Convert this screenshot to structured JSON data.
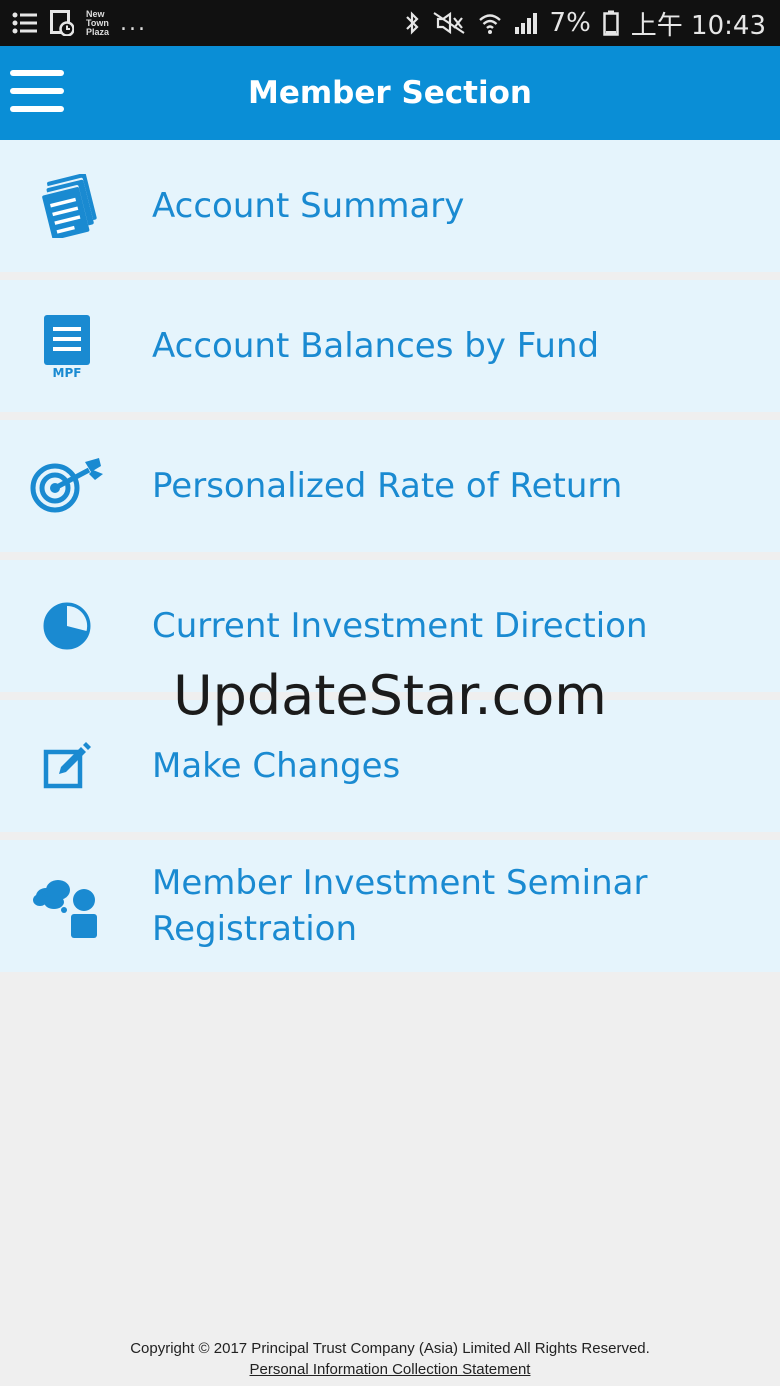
{
  "status_bar": {
    "notification_text": "New Town Plaza",
    "overflow": "...",
    "battery": "7%",
    "time": "上午 10:43"
  },
  "app_bar": {
    "title": "Member Section"
  },
  "menu": {
    "items": [
      {
        "label": "Account Summary",
        "icon": "documents-icon"
      },
      {
        "label": "Account Balances by Fund",
        "icon": "mpf-document-icon",
        "icon_text": "MPF"
      },
      {
        "label": "Personalized Rate of Return",
        "icon": "target-arrow-icon"
      },
      {
        "label": "Current Investment Direction",
        "icon": "pie-chart-icon"
      },
      {
        "label": "Make Changes",
        "icon": "edit-icon"
      },
      {
        "label": "Member Investment Seminar Registration",
        "icon": "seminar-person-icon"
      }
    ]
  },
  "watermark": "UpdateStar.com",
  "footer": {
    "copyright": "Copyright © 2017 Principal Trust Company (Asia) Limited All Rights Reserved.",
    "link": "Personal Information Collection Statement"
  },
  "colors": {
    "primary": "#0a8ed6",
    "item_bg": "#e5f4fc",
    "item_text": "#1a8ad1",
    "page_bg": "#efefef"
  }
}
